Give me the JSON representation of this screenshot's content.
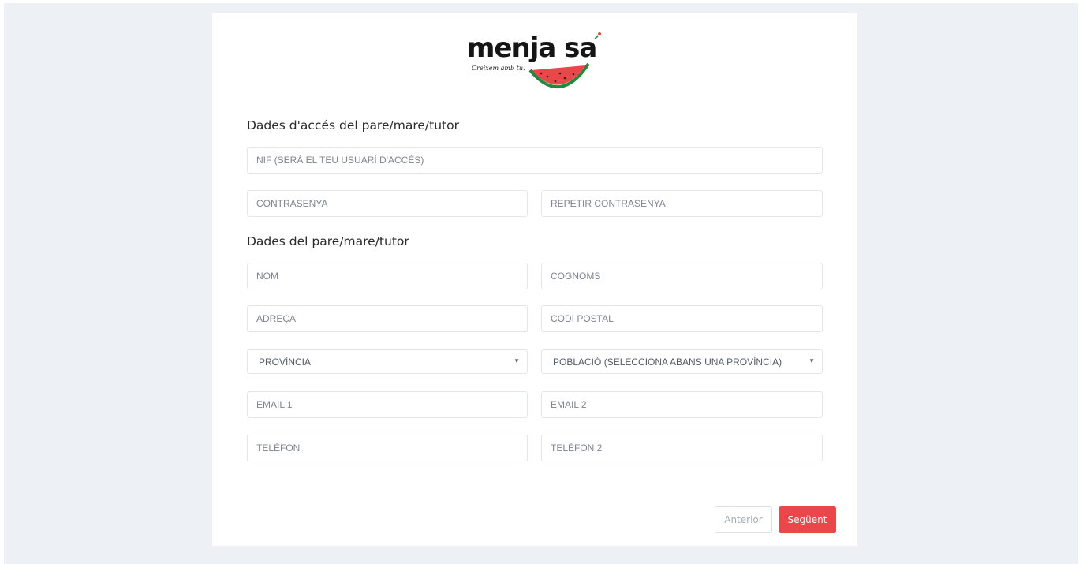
{
  "logo": {
    "brand": "menja sa",
    "tagline": "Creixem amb tu."
  },
  "sections": {
    "access_title": "Dades d'accés del pare/mare/tutor",
    "parent_title": "Dades del pare/mare/tutor"
  },
  "fields": {
    "nif": "NIF (SERÀ EL TEU USUARÍ D'ACCÉS)",
    "password": "CONTRASENYA",
    "repeat_password": "REPETIR CONTRASENYA",
    "name": "NOM",
    "surnames": "COGNOMS",
    "address": "ADREÇA",
    "postal_code": "CODI POSTAL",
    "email1": "EMAIL 1",
    "email2": "EMAIL 2",
    "phone": "TELÈFON",
    "phone2": "TELÈFON 2"
  },
  "selects": {
    "province": "PROVÍNCIA",
    "town": "POBLACIÓ (SELECCIONA ABANS UNA PROVÍNCIA)",
    "caret": "▼"
  },
  "buttons": {
    "previous": "Anterior",
    "next": "Següent"
  },
  "colors": {
    "accent": "#e9474a",
    "background": "#edf0f5"
  }
}
